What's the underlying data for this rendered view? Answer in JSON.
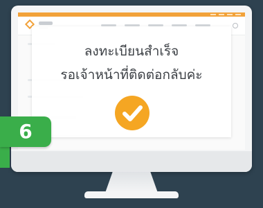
{
  "modal": {
    "line1": "ลงทะเบียนสำเร็จ",
    "line2": "รอเจ้าหน้าที่ติดต่อกลับค่ะ",
    "check_icon": "check-circle-icon"
  },
  "step": {
    "number": "6"
  },
  "colors": {
    "background": "#2e4250",
    "accent": "#f5a623",
    "step_badge": "#3aae4a",
    "monitor": "#f4f5f6"
  }
}
